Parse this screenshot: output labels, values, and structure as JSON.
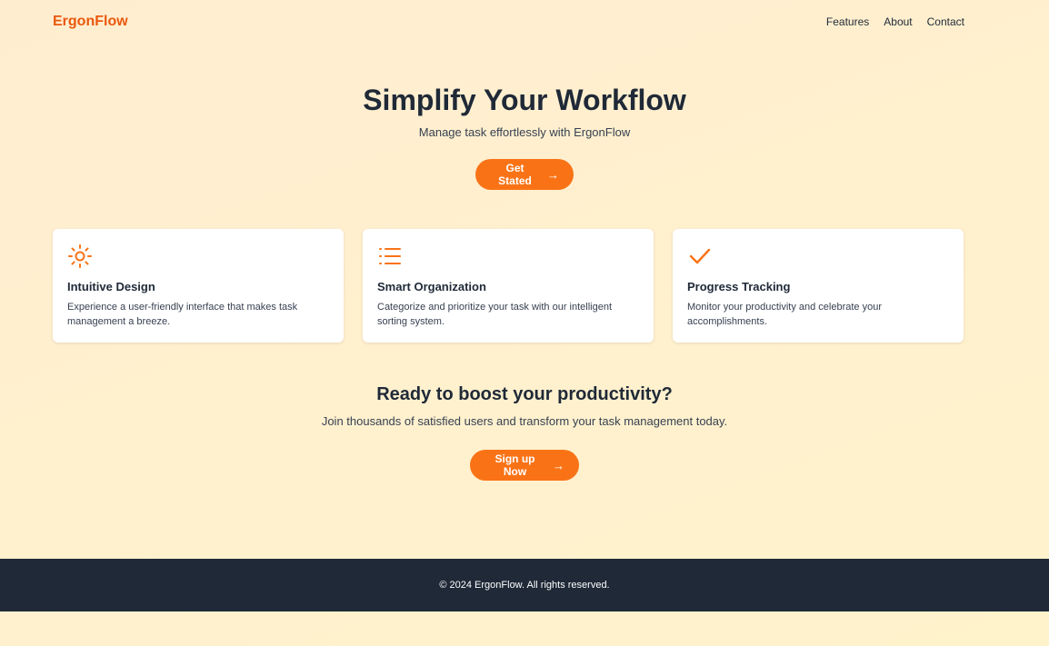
{
  "header": {
    "brand": "ErgonFlow",
    "nav": [
      "Features",
      "About",
      "Contact"
    ]
  },
  "hero": {
    "title": "Simplify Your Workflow",
    "subtitle": "Manage task effortlessly with ErgonFlow",
    "cta_label": "Get Stated",
    "cta_icon": "arrow-right-icon"
  },
  "features": [
    {
      "icon": "sun-icon",
      "title": "Intuitive Design",
      "text": "Experience a user-friendly interface that makes task management a breeze."
    },
    {
      "icon": "list-icon",
      "title": "Smart Organization",
      "text": "Categorize and prioritize your task with our intelligent sorting system."
    },
    {
      "icon": "check-icon",
      "title": "Progress Tracking",
      "text": "Monitor your productivity and celebrate your accomplishments."
    }
  ],
  "cta": {
    "title": "Ready to boost your productivity?",
    "subtitle": "Join thousands of satisfied users and transform your task management today.",
    "button_label": "Sign up Now",
    "button_icon": "arrow-right-icon"
  },
  "footer": {
    "text": "© 2024 ErgonFlow. All rights reserved."
  },
  "colors": {
    "accent": "#f97316",
    "brand": "#ea580c",
    "dark": "#1f2937",
    "background": "#fff1cf"
  }
}
